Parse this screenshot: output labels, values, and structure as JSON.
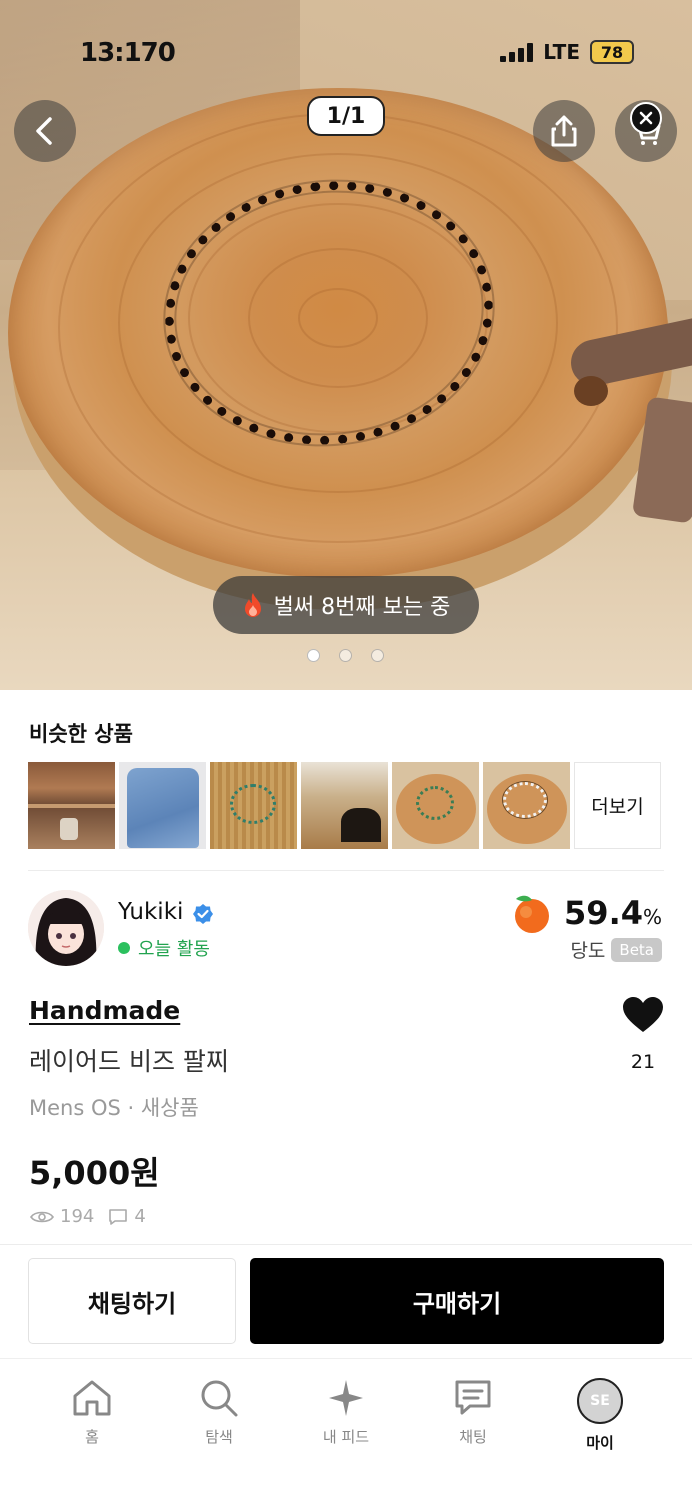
{
  "status_bar": {
    "time": "13:170",
    "network": "LTE",
    "battery": "78"
  },
  "hero": {
    "counter": "1/1",
    "viewing_text": "벌써 8번째 보는 중",
    "dots_total": 3,
    "dots_active": 1
  },
  "similar": {
    "title": "비슷한 상품",
    "more_label": "더보기"
  },
  "seller": {
    "name": "Yukiki",
    "activity": "오늘 활동",
    "temperature_value": "59.4",
    "temperature_unit": "%",
    "temperature_label": "당도",
    "badge": "Beta"
  },
  "product": {
    "brand": "Handmade",
    "name": "레이어드 비즈 팔찌",
    "meta": "Mens OS · 새상품",
    "price": "5,000원",
    "views": "194",
    "comments": "4",
    "likes": "21"
  },
  "actions": {
    "chat": "채팅하기",
    "buy": "구매하기"
  },
  "tabbar": {
    "home": "홈",
    "search": "탐색",
    "feed": "내 피드",
    "chat": "채팅",
    "my": "마이",
    "my_badge": "SE"
  },
  "colors": {
    "accent_green": "#2bc05e",
    "verified_blue": "#3b8fe8",
    "buy_bg": "#000000"
  }
}
